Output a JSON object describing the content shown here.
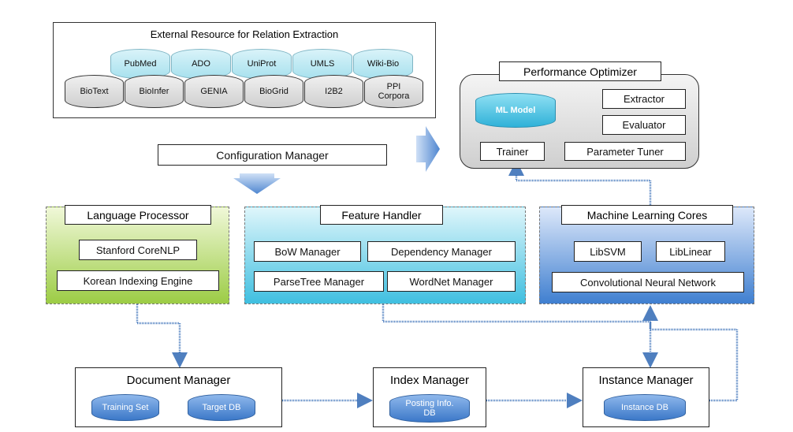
{
  "external_resources": {
    "title": "External Resource for Relation Extraction",
    "top_row": [
      "PubMed",
      "ADO",
      "UniProt",
      "UMLS",
      "Wiki-Bio"
    ],
    "bottom_row": [
      "BioText",
      "BioInfer",
      "GENIA",
      "BioGrid",
      "I2B2",
      "PPI Corpora"
    ]
  },
  "performance_optimizer": {
    "title": "Performance Optimizer",
    "ml_model": "ML Model",
    "extractor": "Extractor",
    "evaluator": "Evaluator",
    "trainer": "Trainer",
    "parameter_tuner": "Parameter Tuner"
  },
  "configuration_manager": "Configuration Manager",
  "language_processor": {
    "title": "Language Processor",
    "items": [
      "Stanford CoreNLP",
      "Korean Indexing Engine"
    ]
  },
  "feature_handler": {
    "title": "Feature Handler",
    "items": [
      "BoW Manager",
      "Dependency Manager",
      "ParseTree Manager",
      "WordNet Manager"
    ]
  },
  "ml_cores": {
    "title": "Machine Learning Cores",
    "items": [
      "LibSVM",
      "LibLinear",
      "Convolutional Neural Network"
    ]
  },
  "document_manager": {
    "title": "Document Manager",
    "dbs": [
      "Training Set",
      "Target DB"
    ]
  },
  "index_manager": {
    "title": "Index Manager",
    "dbs": [
      "Posting Info. DB"
    ]
  },
  "instance_manager": {
    "title": "Instance Manager",
    "dbs": [
      "Instance DB"
    ]
  },
  "colors": {
    "connector": "#4f7fbf",
    "language_processor": "#9ccc45",
    "feature_handler": "#3fbfe0",
    "ml_cores": "#3f7fd0"
  }
}
